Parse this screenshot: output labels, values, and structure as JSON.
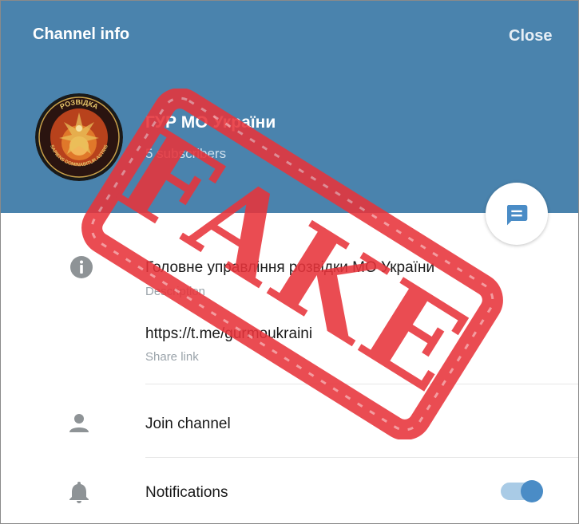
{
  "header": {
    "title": "Channel info",
    "close_label": "Close"
  },
  "channel": {
    "name": "ГУР МО України",
    "subscribers": "5 subscribers",
    "avatar_text_top": "РОЗВІДКА",
    "avatar_text_left": "ВОЄННА",
    "avatar_text_right": "УКРАЇНИ",
    "avatar_motto": "SAPIENS DOMINABITUR ASTRIS"
  },
  "info": {
    "description": "Головне управління розвідки МО України",
    "description_label": "Description",
    "link": "https://t.me/gurmoukraini",
    "link_label": "Share link"
  },
  "actions": {
    "join_label": "Join channel",
    "notifications_label": "Notifications",
    "notifications_on": true
  },
  "stamp": {
    "text": "FAKE",
    "color": "#e8343b"
  },
  "colors": {
    "header_bg": "#4a83ad",
    "accent": "#4a8cc6",
    "toggle_track": "#a9cbe6"
  }
}
